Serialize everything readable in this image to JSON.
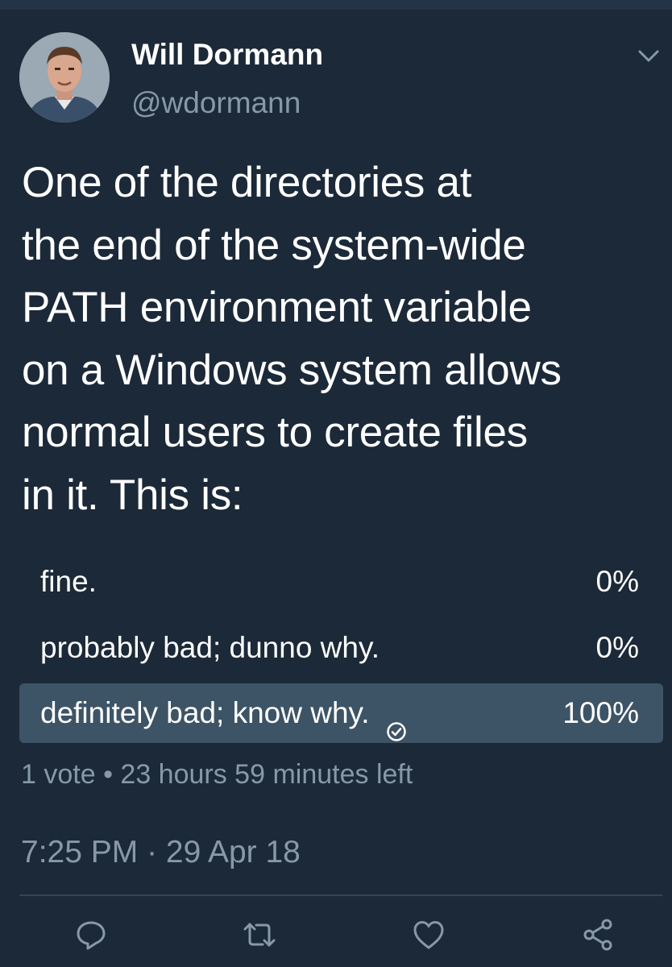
{
  "author": {
    "name": "Will Dormann",
    "handle": "@wdormann"
  },
  "tweet": {
    "lines": [
      "One of the directories at",
      "the end of the system-wide",
      "PATH environment variable",
      "on a Windows system allows",
      "normal users to create files",
      "in it. This is:"
    ]
  },
  "poll": {
    "options": [
      {
        "label": "fine.",
        "percent_text": "0%",
        "percent": 0
      },
      {
        "label": "probably bad; dunno why.",
        "percent_text": "0%",
        "percent": 0
      },
      {
        "label": "definitely bad; know why.",
        "percent_text": "100%",
        "percent": 100,
        "selected": true
      }
    ],
    "meta": "1 vote • 23 hours 59 minutes left"
  },
  "timestamp": "7:25 PM · 29 Apr 18",
  "actions": [
    {
      "name": "reply",
      "icon": "reply-icon"
    },
    {
      "name": "retweet",
      "icon": "retweet-icon"
    },
    {
      "name": "like",
      "icon": "heart-icon"
    },
    {
      "name": "share",
      "icon": "share-icon"
    }
  ],
  "colors": {
    "background": "#1c2938",
    "secondary_text": "#8899a6",
    "poll_fill": "#3d5466",
    "divider": "#38444d"
  }
}
